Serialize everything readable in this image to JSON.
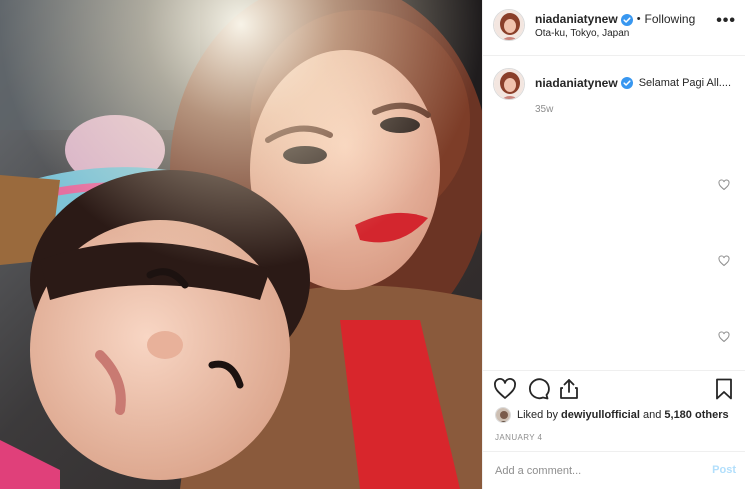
{
  "post": {
    "username": "niadaniatynew",
    "follow_status": "Following",
    "separator": "•",
    "location": "Ota-ku, Tokyo, Japan",
    "more_glyph": "•••"
  },
  "caption": {
    "username": "niadaniatynew",
    "text": "Selamat Pagi All....",
    "time": "35w"
  },
  "engagement": {
    "liked_by_prefix": "Liked by",
    "liked_by_user": "dewiyullofficial",
    "and_text": "and",
    "others_count": "5,180 others",
    "date": "JANUARY 4"
  },
  "comment_box": {
    "placeholder": "Add a comment...",
    "post_label": "Post"
  },
  "icons": {
    "verified": "verified-badge-icon",
    "like": "heart-icon",
    "comment": "comment-bubble-icon",
    "share": "share-icon",
    "save": "bookmark-icon"
  },
  "colors": {
    "verified_blue": "#3897f0",
    "post_button_disabled": "#b2dffc",
    "muted_text": "#8e8e8e",
    "divider": "#efefef"
  }
}
